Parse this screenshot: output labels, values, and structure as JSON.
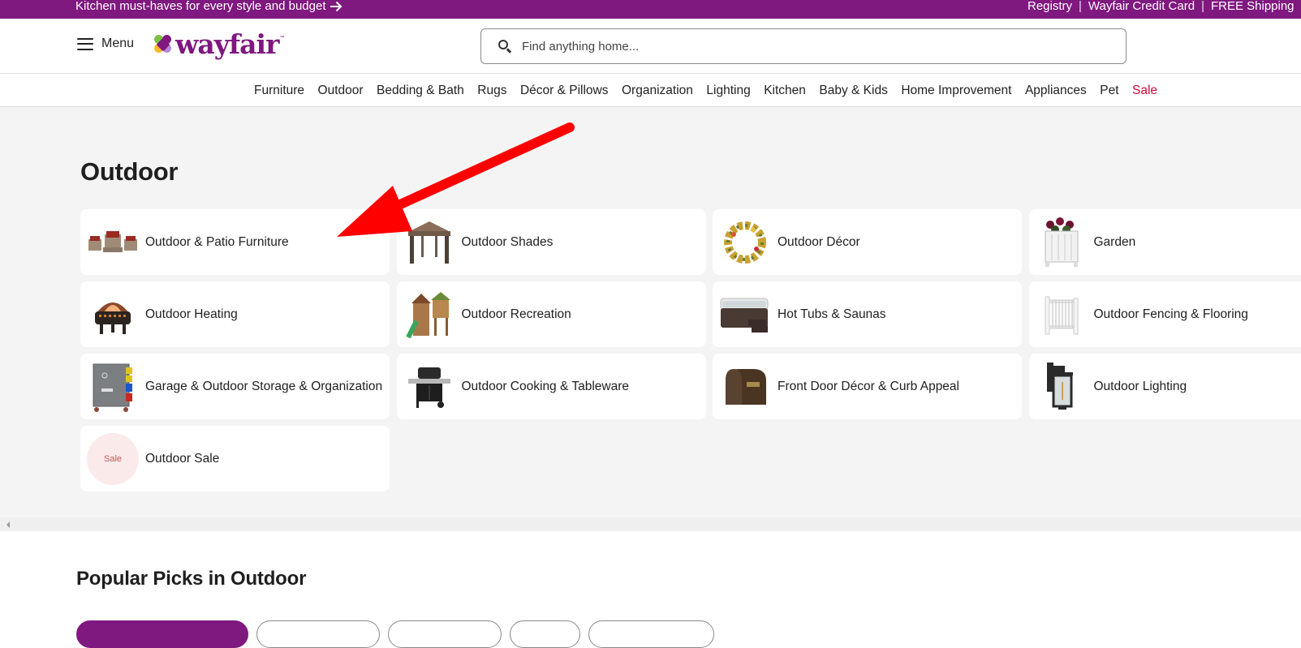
{
  "promo_bar": {
    "message": "Kitchen must-haves for every style and budget",
    "arrow_icon": "arrow-right-icon",
    "links": [
      "Registry",
      "Wayfair Credit Card",
      "FREE Shipping"
    ],
    "separator": "|"
  },
  "header": {
    "menu_label": "Menu",
    "logo_text": "wayfair",
    "logo_tm": "™",
    "search": {
      "placeholder": "Find anything home...",
      "value": ""
    }
  },
  "nav": {
    "items": [
      "Furniture",
      "Outdoor",
      "Bedding & Bath",
      "Rugs",
      "Décor & Pillows",
      "Organization",
      "Lighting",
      "Kitchen",
      "Baby & Kids",
      "Home Improvement",
      "Appliances",
      "Pet",
      "Sale"
    ]
  },
  "main": {
    "title": "Outdoor",
    "categories": [
      {
        "label": "Outdoor & Patio Furniture",
        "icon": "patio-furniture-image"
      },
      {
        "label": "Outdoor Shades",
        "icon": "gazebo-image"
      },
      {
        "label": "Outdoor Décor",
        "icon": "wreath-image"
      },
      {
        "label": "Garden",
        "icon": "planter-image"
      },
      {
        "label": "Outdoor Heating",
        "icon": "fire-pit-image"
      },
      {
        "label": "Outdoor Recreation",
        "icon": "playset-image"
      },
      {
        "label": "Hot Tubs & Saunas",
        "icon": "hot-tub-image"
      },
      {
        "label": "Outdoor Fencing & Flooring",
        "icon": "fence-image"
      },
      {
        "label": "Garage & Outdoor Storage & Organization",
        "icon": "pegboard-image"
      },
      {
        "label": "Outdoor Cooking & Tableware",
        "icon": "grill-image"
      },
      {
        "label": "Front Door Décor & Curb Appeal",
        "icon": "mailbox-image"
      },
      {
        "label": "Outdoor Lighting",
        "icon": "wall-lantern-image"
      },
      {
        "label": "Outdoor Sale",
        "icon": "sale-badge",
        "badge_text": "Sale"
      }
    ]
  },
  "popular": {
    "title": "Popular Picks in Outdoor"
  },
  "colors": {
    "brand": "#7f187f",
    "sale": "#cc0c39",
    "annotation_arrow": "#ff0000"
  }
}
